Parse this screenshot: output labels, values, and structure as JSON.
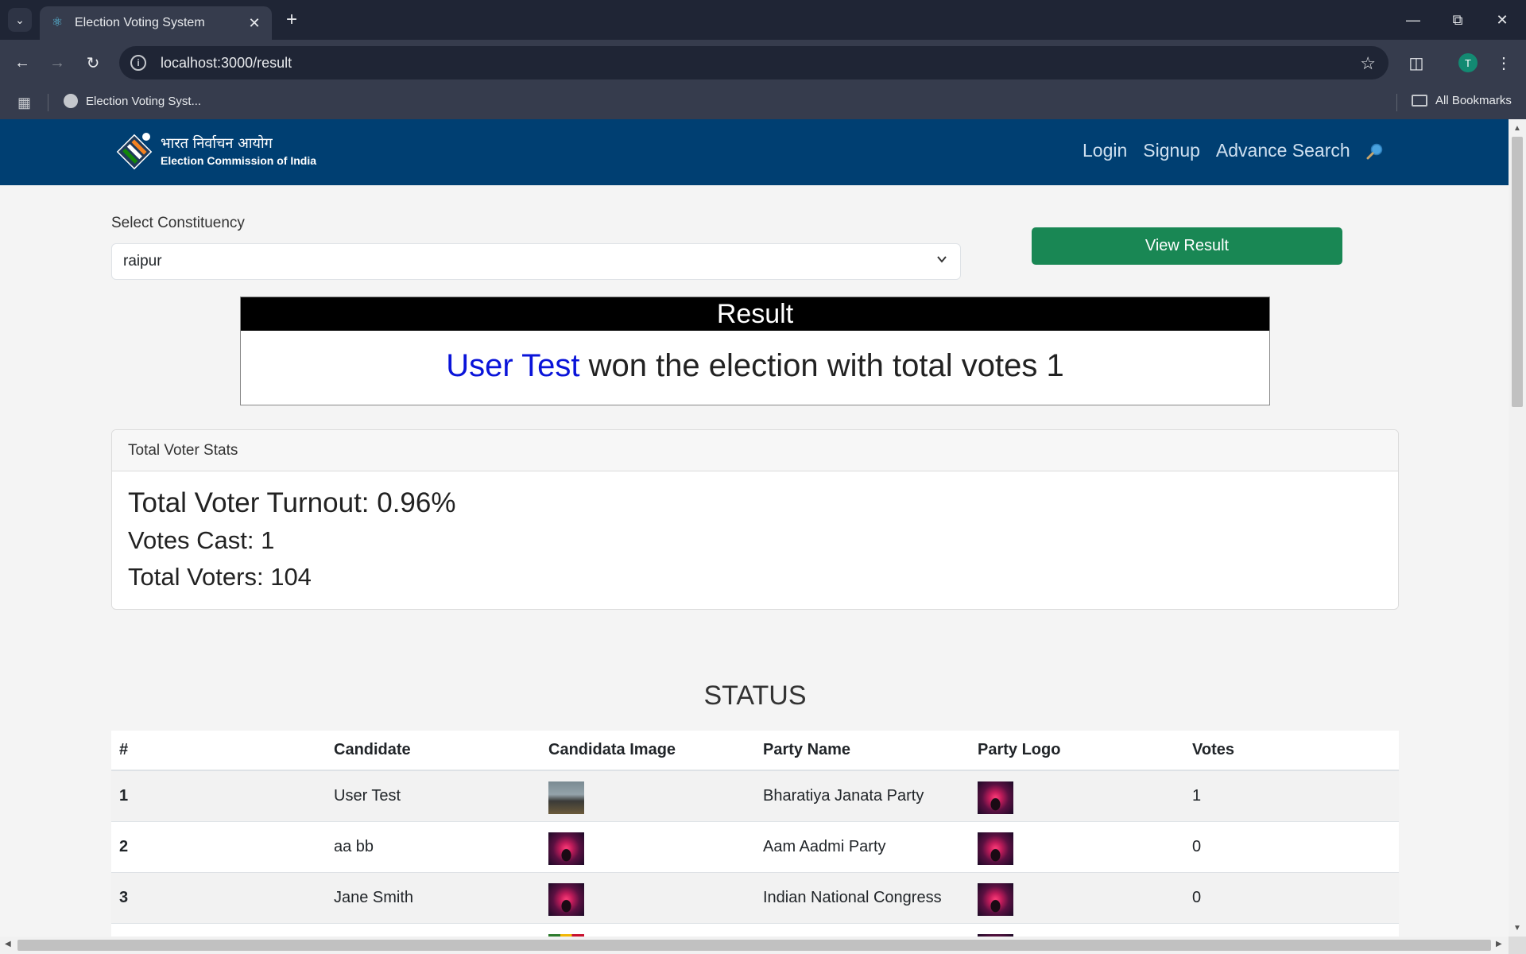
{
  "browser": {
    "tab_title": "Election Voting System",
    "url": "localhost:3000/result",
    "bookmark_item": "Election Voting Syst...",
    "all_bookmarks": "All Bookmarks",
    "profile_initial": "T"
  },
  "site": {
    "logo_hindi": "भारत निर्वाचन आयोग",
    "logo_english": "Election Commission of India",
    "nav": {
      "login": "Login",
      "signup": "Signup",
      "advance_search": "Advance Search"
    }
  },
  "form": {
    "label": "Select Constituency",
    "selected": "raipur",
    "button": "View Result"
  },
  "result": {
    "header": "Result",
    "winner": "User Test",
    "text": " won the election with total votes 1"
  },
  "stats": {
    "header": "Total Voter Stats",
    "turnout": "Total Voter Turnout: 0.96%",
    "votes_cast": "Votes Cast: 1",
    "total_voters": "Total Voters: 104"
  },
  "status": {
    "title": "STATUS",
    "columns": [
      "#",
      "Candidate",
      "Candidata Image",
      "Party Name",
      "Party Logo",
      "Votes"
    ],
    "rows": [
      {
        "num": "1",
        "candidate": "User Test",
        "candidate_image": "road-photo",
        "party": "Bharatiya Janata Party",
        "party_logo": "tree-photo",
        "votes": "1"
      },
      {
        "num": "2",
        "candidate": "aa bb",
        "candidate_image": "tree-photo",
        "party": "Aam Aadmi Party",
        "party_logo": "tree-photo",
        "votes": "0"
      },
      {
        "num": "3",
        "candidate": "Jane Smith",
        "candidate_image": "tree-photo",
        "party": "Indian National Congress",
        "party_logo": "tree-photo",
        "votes": "0"
      }
    ]
  },
  "colors": {
    "navbar": "#003f72",
    "button_green": "#198754",
    "winner_blue": "#0a14d9"
  }
}
